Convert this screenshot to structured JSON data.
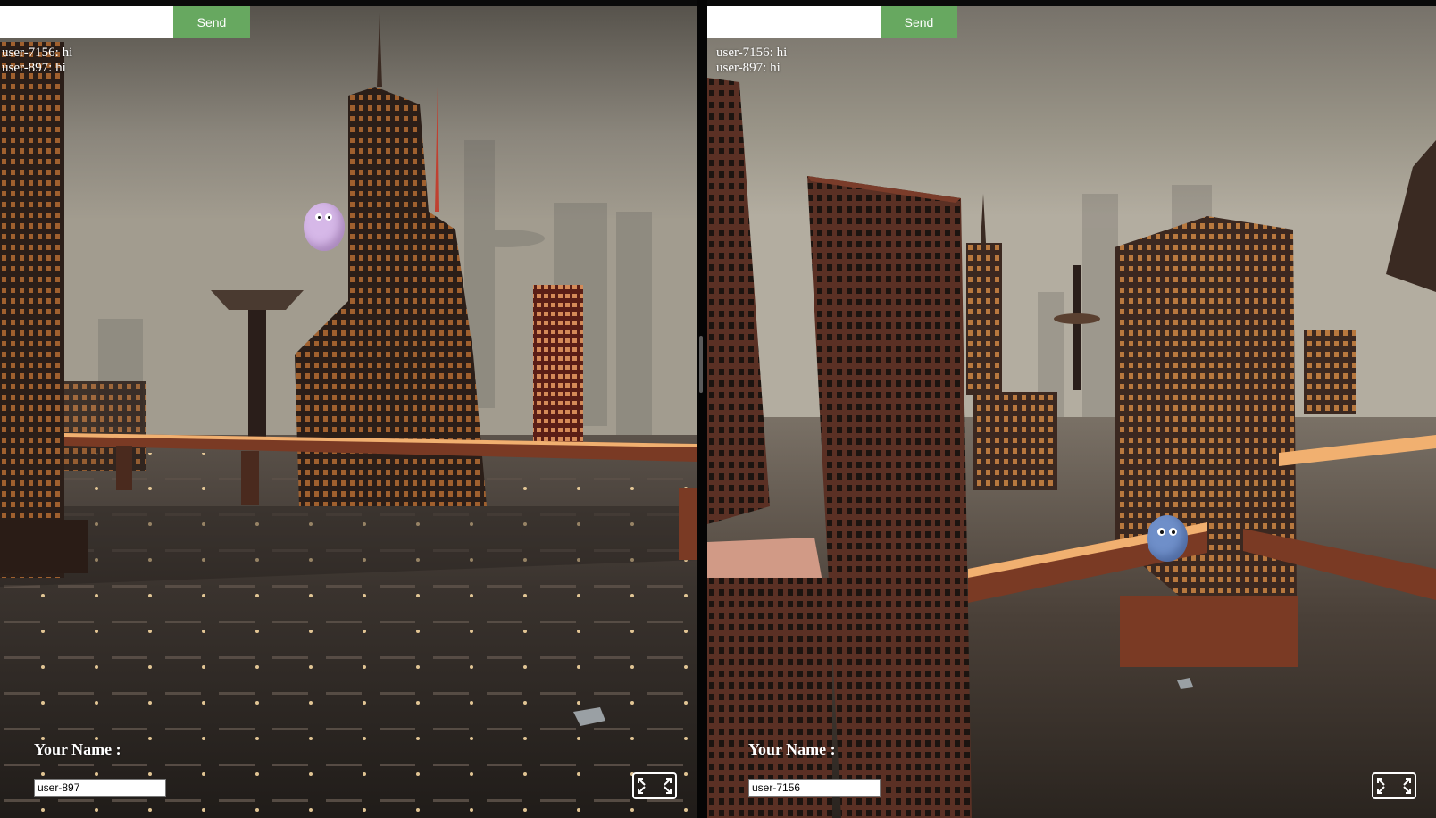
{
  "left_view": {
    "chat": {
      "input_value": "",
      "send_label": "Send"
    },
    "messages": [
      {
        "text": "user-7156: hi"
      },
      {
        "text": "user-897: hi"
      }
    ],
    "name_label": "Your Name :",
    "name_value": "user-897",
    "avatar_color": "#d6b8e8"
  },
  "right_view": {
    "chat": {
      "input_value": "",
      "send_label": "Send"
    },
    "messages": [
      {
        "text": "user-7156: hi"
      },
      {
        "text": "user-897: hi"
      }
    ],
    "name_label": "Your Name :",
    "name_value": "user-7156",
    "avatar_color": "#6f8fc9"
  },
  "colors": {
    "send_button": "#67a860",
    "sky": "#9a9588",
    "ground": "#2f2925"
  },
  "icons": {
    "fullscreen": "expand-arrows-icon"
  }
}
